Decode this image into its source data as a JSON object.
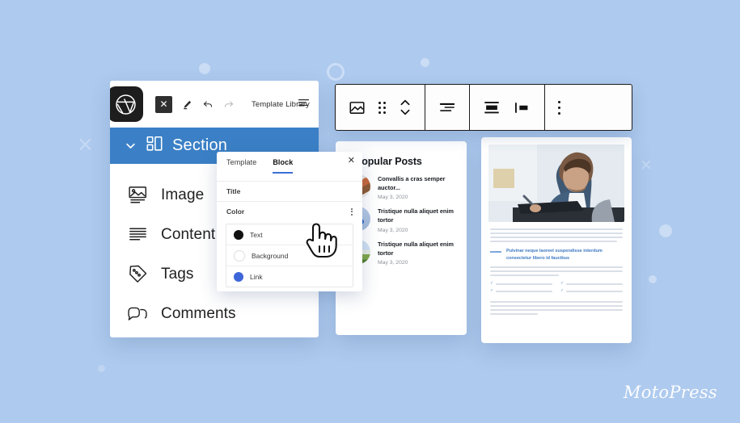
{
  "meta": {
    "background_color": "#aecaee",
    "accent_blue": "#3b80c6",
    "link_blue": "#3f66d8",
    "tab_underline": "#3b6fd4"
  },
  "editor_panel": {
    "logo_icon": "wordpress-icon",
    "toolbar": {
      "close_label": "✕",
      "items": [
        {
          "name": "close-square-button",
          "label": "✕"
        },
        {
          "name": "edit-pencil-icon",
          "label": ""
        },
        {
          "name": "undo-icon",
          "label": ""
        },
        {
          "name": "redo-icon",
          "label": ""
        }
      ],
      "template_library_label": "Template Library",
      "list_view_icon": "list-view-icon"
    },
    "section_row": {
      "label": "Section",
      "chevron_icon": "chevron-down-icon",
      "blocks_icon": "layout-blocks-icon"
    },
    "nav_items": [
      {
        "label": "Image",
        "icon": "image-icon"
      },
      {
        "label": "Content",
        "icon": "content-lines-icon"
      },
      {
        "label": "Tags",
        "icon": "tag-icon"
      },
      {
        "label": "Comments",
        "icon": "comments-icon"
      }
    ]
  },
  "settings_popover": {
    "tabs": [
      {
        "label": "Template",
        "active": false
      },
      {
        "label": "Block",
        "active": true
      }
    ],
    "close_label": "✕",
    "sections": [
      {
        "label": "Title",
        "kebab": false
      },
      {
        "label": "Color",
        "kebab": true
      }
    ],
    "colors": [
      {
        "label": "Text",
        "swatch": "#111111"
      },
      {
        "label": "Background",
        "swatch": "#ffffff"
      },
      {
        "label": "Link",
        "swatch": "#3f66d8"
      }
    ],
    "cursor_icon": "pointing-hand-cursor"
  },
  "block_toolbar": {
    "groups": [
      {
        "buttons": [
          {
            "name": "image-block-icon",
            "label": ""
          },
          {
            "name": "drag-handle-icon",
            "label": ""
          },
          {
            "name": "move-up-down-icon",
            "label": ""
          }
        ]
      },
      {
        "buttons": [
          {
            "name": "align-text-icon",
            "label": ""
          }
        ]
      },
      {
        "buttons": [
          {
            "name": "align-center-block-icon",
            "label": ""
          },
          {
            "name": "align-left-block-icon",
            "label": ""
          }
        ]
      },
      {
        "buttons": [
          {
            "name": "more-options-kebab-icon",
            "label": ""
          }
        ]
      }
    ]
  },
  "popular_posts": {
    "title": "Popular Posts",
    "items": [
      {
        "title": "Convallis a cras semper auctor...",
        "date": "May 3, 2020",
        "thumb": "coffee-desk-photo"
      },
      {
        "title": "Tristique nulla aliquet enim tortor",
        "date": "May 3, 2020",
        "thumb": "paint-supplies-photo"
      },
      {
        "title": "Tristique nulla aliquet enim tortor",
        "date": "May 3, 2020",
        "thumb": "field-landscape-photo"
      }
    ]
  },
  "document_preview": {
    "photo_alt": "man-writing-at-desk-photo",
    "heading": "Pulvinar neque laoreet suspendisse interdum consectetur libero id faucibus"
  },
  "brand": {
    "logo_text": "MotoPress"
  }
}
